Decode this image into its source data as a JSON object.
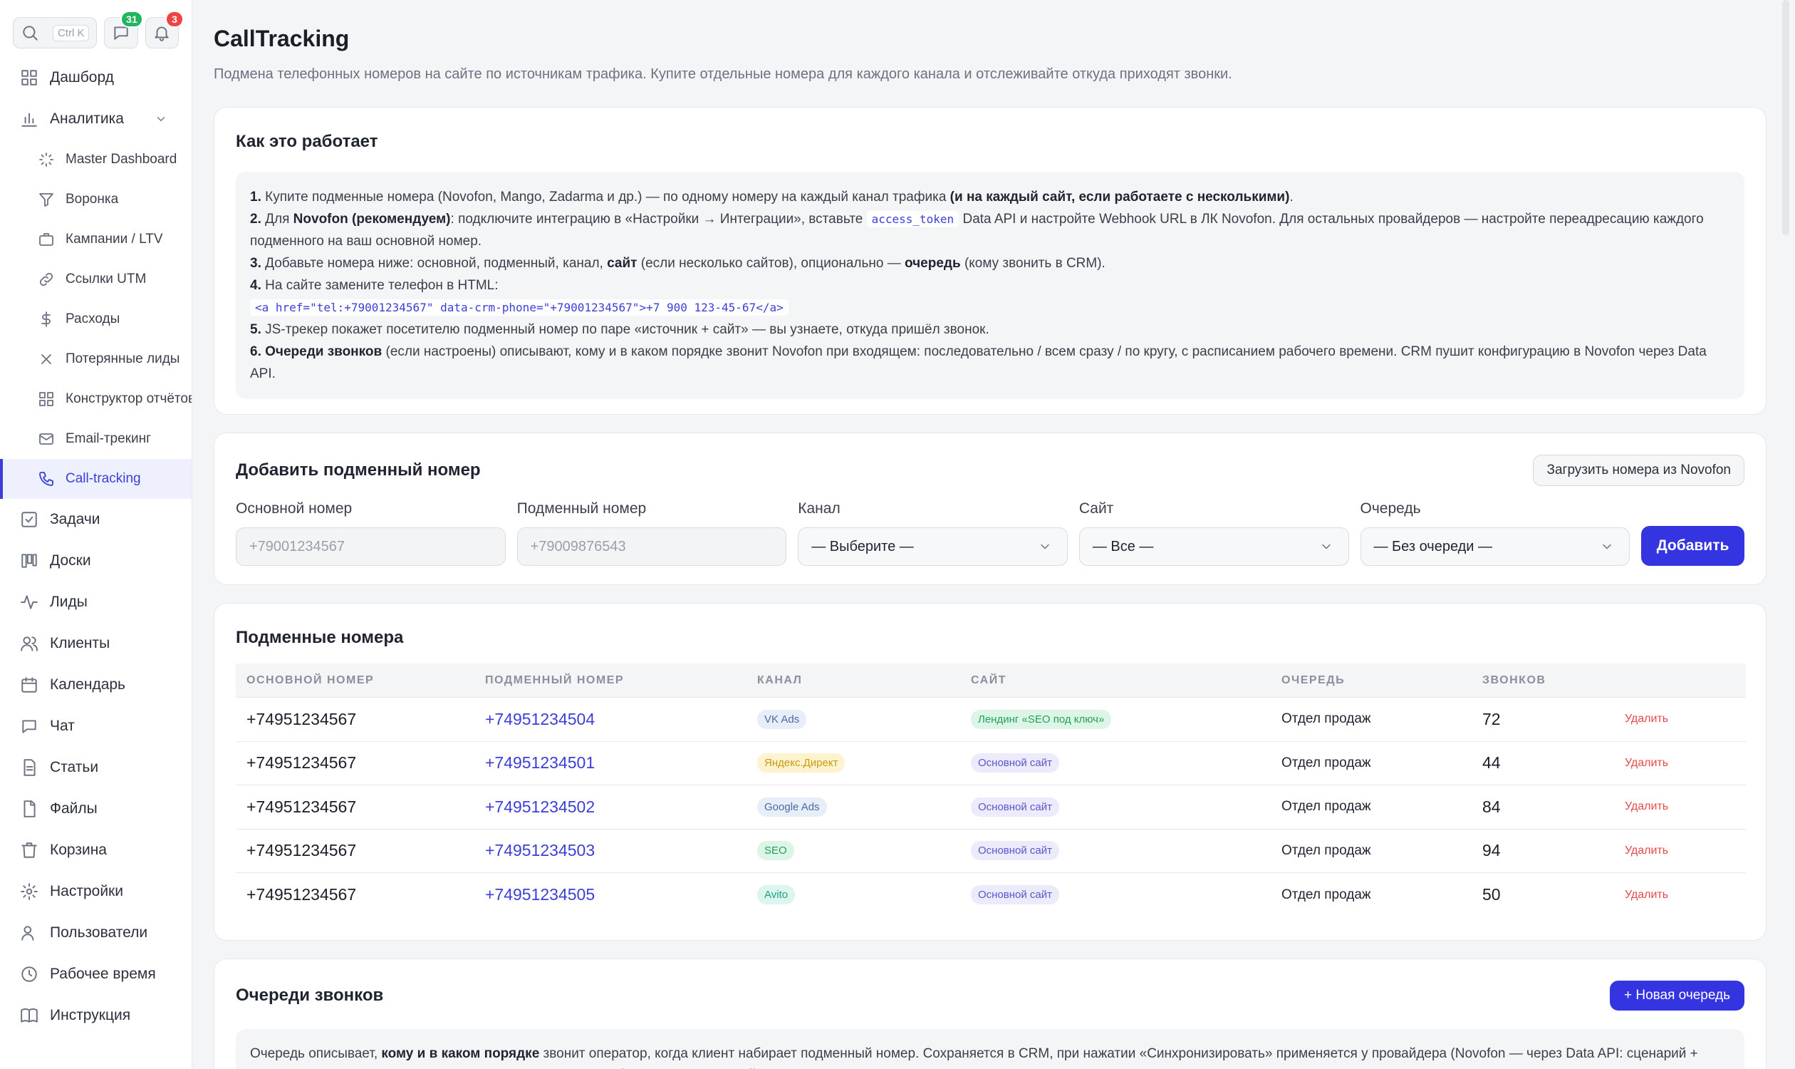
{
  "sidebar": {
    "search_kbd": "Ctrl K",
    "chat_badge": "31",
    "notif_badge": "3",
    "items": [
      {
        "label": "Дашборд",
        "icon": "dashboard-icon"
      },
      {
        "label": "Аналитика",
        "icon": "chart-bar-icon"
      }
    ],
    "sub_items": [
      {
        "label": "Master Dashboard",
        "icon": "loader-icon"
      },
      {
        "label": "Воронка",
        "icon": "funnel-icon"
      },
      {
        "label": "Кампании / LTV",
        "icon": "briefcase-icon"
      },
      {
        "label": "Ссылки UTM",
        "icon": "link-icon"
      },
      {
        "label": "Расходы",
        "icon": "dollar-icon"
      },
      {
        "label": "Потерянные лиды",
        "icon": "x-icon"
      },
      {
        "label": "Конструктор отчётов",
        "icon": "grid-icon"
      },
      {
        "label": "Email-трекинг",
        "icon": "mail-icon"
      },
      {
        "label": "Call-tracking",
        "icon": "phone-icon"
      }
    ],
    "bottom_items": [
      {
        "label": "Задачи",
        "icon": "checkbox-icon"
      },
      {
        "label": "Доски",
        "icon": "kanban-icon"
      },
      {
        "label": "Лиды",
        "icon": "activity-icon"
      },
      {
        "label": "Клиенты",
        "icon": "users-icon"
      },
      {
        "label": "Календарь",
        "icon": "calendar-icon"
      },
      {
        "label": "Чат",
        "icon": "chat-icon"
      },
      {
        "label": "Статьи",
        "icon": "document-icon"
      },
      {
        "label": "Файлы",
        "icon": "file-icon"
      },
      {
        "label": "Корзина",
        "icon": "trash-icon"
      },
      {
        "label": "Настройки",
        "icon": "gear-icon"
      },
      {
        "label": "Пользователи",
        "icon": "user-icon"
      },
      {
        "label": "Рабочее время",
        "icon": "clock-icon"
      },
      {
        "label": "Инструкция",
        "icon": "book-icon"
      }
    ]
  },
  "page": {
    "title": "CallTracking",
    "subtitle": "Подмена телефонных номеров на сайте по источникам трафика. Купите отдельные номера для каждого канала и отслеживайте откуда приходят звонки."
  },
  "howto": {
    "title": "Как это работает",
    "s1_num": "1.",
    "s1_text": " Купите подменные номера (Novofon, Mango, Zadarma и др.) — по одному номеру на каждый канал трафика ",
    "s1_bold": "(и на каждый сайт, если работаете с несколькими)",
    "s1_end": ".",
    "s2_num": "2.",
    "s2_text_a": " Для ",
    "s2_bold": "Novofon (рекомендуем)",
    "s2_text_b": ": подключите интеграцию в «Настройки → Интеграции», вставьте ",
    "s2_code": "access_token",
    "s2_text_c": " Data API и настройте Webhook URL в ЛК Novofon. Для остальных провайдеров — настройте переадресацию каждого подменного на ваш основной номер.",
    "s3_num": "3.",
    "s3_text_a": " Добавьте номера ниже: основной, подменный, канал, ",
    "s3_bold_a": "сайт",
    "s3_text_b": " (если несколько сайтов), опционально — ",
    "s3_bold_b": "очередь",
    "s3_text_c": " (кому звонить в CRM).",
    "s4_num": "4.",
    "s4_text": " На сайте замените телефон в HTML:",
    "s4_code": "<a href=\"tel:+79001234567\" data-crm-phone=\"+79001234567\">+7 900 123-45-67</a>",
    "s5_num": "5.",
    "s5_text": " JS-трекер покажет посетителю подменный номер по паре «источник + сайт» — вы узнаете, откуда пришёл звонок.",
    "s6_num": "6.",
    "s6_bold": " Очереди звонков",
    "s6_text": " (если настроены) описывают, кому и в каком порядке звонит Novofon при входящем: последовательно / всем сразу / по кругу, с расписанием рабочего времени. CRM пушит конфигурацию в Novofon через Data API."
  },
  "add_form": {
    "title": "Добавить подменный номер",
    "load_button": "Загрузить номера из Novofon",
    "main_label": "Основной номер",
    "main_placeholder": "+79001234567",
    "sub_label": "Подменный номер",
    "sub_placeholder": "+79009876543",
    "channel_label": "Канал",
    "channel_value": "— Выберите —",
    "site_label": "Сайт",
    "site_value": "— Все —",
    "queue_label": "Очередь",
    "queue_value": "— Без очереди —",
    "add_button": "Добавить"
  },
  "numbers_table": {
    "title": "Подменные номера",
    "headers": [
      "Основной номер",
      "Подменный номер",
      "Канал",
      "Сайт",
      "Очередь",
      "Звонков"
    ],
    "delete_label": "Удалить",
    "rows": [
      {
        "main": "+74951234567",
        "sub": "+74951234504",
        "channel": "VK Ads",
        "site": "Лендинг «SEO под ключ»",
        "queue": "Отдел продаж",
        "calls": "72"
      },
      {
        "main": "+74951234567",
        "sub": "+74951234501",
        "channel": "Яндекс.Директ",
        "site": "Основной сайт",
        "queue": "Отдел продаж",
        "calls": "44"
      },
      {
        "main": "+74951234567",
        "sub": "+74951234502",
        "channel": "Google Ads",
        "site": "Основной сайт",
        "queue": "Отдел продаж",
        "calls": "84"
      },
      {
        "main": "+74951234567",
        "sub": "+74951234503",
        "channel": "SEO",
        "site": "Основной сайт",
        "queue": "Отдел продаж",
        "calls": "94"
      },
      {
        "main": "+74951234567",
        "sub": "+74951234505",
        "channel": "Avito",
        "site": "Основной сайт",
        "queue": "Отдел продаж",
        "calls": "50"
      }
    ],
    "pill_colors": {
      "VK Ads": {
        "bg": "#e8eef8",
        "fg": "#4a6aa5"
      },
      "Яндекс.Директ": {
        "bg": "#fdf3cf",
        "fg": "#c99a10"
      },
      "Google Ads": {
        "bg": "#e8eef8",
        "fg": "#4a6aa5"
      },
      "SEO": {
        "bg": "#dcf5e7",
        "fg": "#22a05a"
      },
      "Avito": {
        "bg": "#dcf5ef",
        "fg": "#1fa085"
      },
      "site_landing": {
        "bg": "#dcf5e7",
        "fg": "#22a05a"
      },
      "site_main": {
        "bg": "#ecebfb",
        "fg": "#5a57c8"
      }
    }
  },
  "queues": {
    "title": "Очереди звонков",
    "new_button": "+ Новая очередь",
    "text_a": "Очередь описывает, ",
    "text_bold": "кому и в каком порядке",
    "text_b": " звонит оператор, когда клиент набирает подменный номер. Сохраняется в CRM, при нажатии «Синхронизировать» применяется у провайдера (Novofon — через Data API: сценарий + группа + расписание; Plusofon — через REST API). Для работы нужен валидный токен в интеграции."
  }
}
